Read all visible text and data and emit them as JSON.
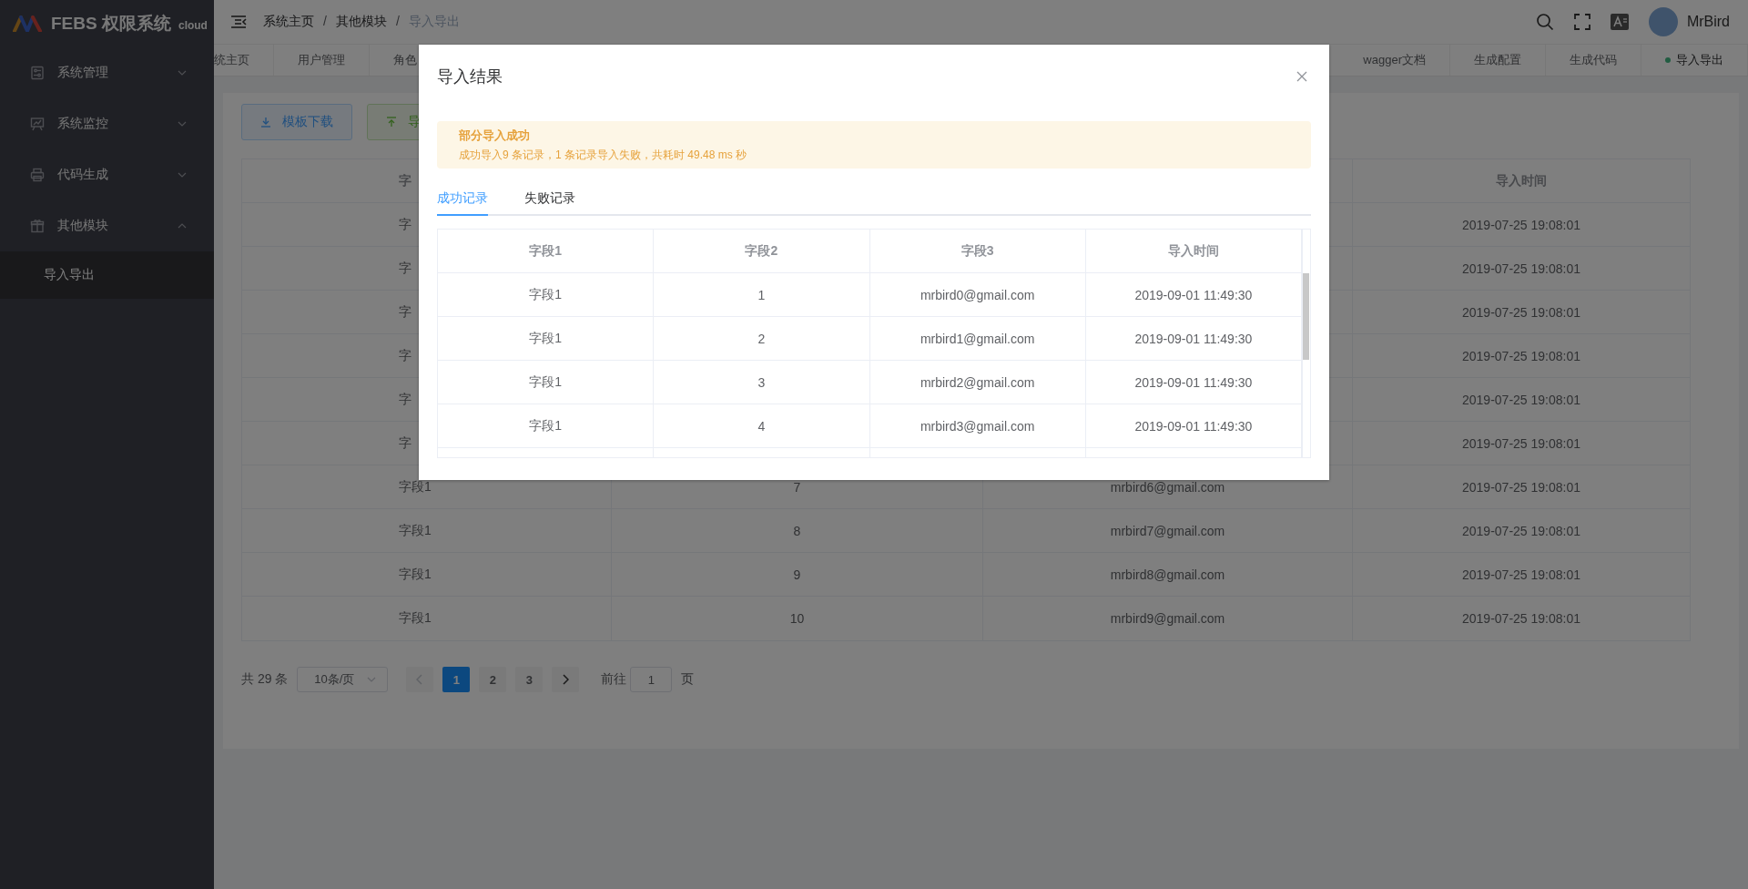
{
  "app": {
    "logo_text": "FEBS 权限系统",
    "logo_suffix": "cloud"
  },
  "sidebar": {
    "items": [
      {
        "label": "系统管理",
        "expanded": false
      },
      {
        "label": "系统监控",
        "expanded": false
      },
      {
        "label": "代码生成",
        "expanded": false
      },
      {
        "label": "其他模块",
        "expanded": true,
        "children": [
          {
            "label": "导入导出",
            "selected": true
          }
        ]
      }
    ]
  },
  "header": {
    "breadcrumb": [
      "系统主页",
      "其他模块",
      "导入导出"
    ],
    "breadcrumb_separator": "/",
    "user": "MrBird"
  },
  "tabs_left": [
    {
      "label": "统主页",
      "selected": false
    },
    {
      "label": "用户管理",
      "selected": false
    },
    {
      "label": "角色",
      "selected": false
    }
  ],
  "tabs_right": [
    {
      "label": "wagger文档",
      "selected": false
    },
    {
      "label": "生成配置",
      "selected": false
    },
    {
      "label": "生成代码",
      "selected": false
    },
    {
      "label": "导入导出",
      "selected": true
    }
  ],
  "toolbar": {
    "buttons": [
      {
        "label": "模板下载",
        "kind": "download"
      },
      {
        "label": "导",
        "kind": "upload"
      }
    ]
  },
  "table": {
    "columns": [
      "字",
      null,
      null,
      "导入时间"
    ],
    "rows": [
      [
        "字",
        null,
        null,
        "2019-07-25 19:08:01"
      ],
      [
        "字",
        null,
        null,
        "2019-07-25 19:08:01"
      ],
      [
        "字",
        null,
        null,
        "2019-07-25 19:08:01"
      ],
      [
        "字",
        null,
        null,
        "2019-07-25 19:08:01"
      ],
      [
        "字",
        null,
        null,
        "2019-07-25 19:08:01"
      ],
      [
        "字",
        null,
        null,
        "2019-07-25 19:08:01"
      ],
      [
        "字段1",
        "7",
        "mrbird6@gmail.com",
        "2019-07-25 19:08:01"
      ],
      [
        "字段1",
        "8",
        "mrbird7@gmail.com",
        "2019-07-25 19:08:01"
      ],
      [
        "字段1",
        "9",
        "mrbird8@gmail.com",
        "2019-07-25 19:08:01"
      ],
      [
        "字段1",
        "10",
        "mrbird9@gmail.com",
        "2019-07-25 19:08:01"
      ]
    ]
  },
  "pagination": {
    "total": "共 29 条",
    "page_size": "10条/页",
    "pages": [
      {
        "label": "1",
        "selected": true
      },
      {
        "label": "2",
        "selected": false
      },
      {
        "label": "3",
        "selected": false
      }
    ],
    "goto_label": "前往",
    "goto_value": "1",
    "goto_suffix": "页"
  },
  "dialog": {
    "title": "导入结果",
    "alert": {
      "title": "部分导入成功",
      "message": "成功导入9 条记录，1 条记录导入失败，共耗时 49.48 ms 秒"
    },
    "tabs": [
      {
        "label": "成功记录",
        "selected": true
      },
      {
        "label": "失败记录",
        "selected": false
      }
    ],
    "table": {
      "columns": [
        "字段1",
        "字段2",
        "字段3",
        "导入时间"
      ],
      "rows": [
        [
          "字段1",
          "1",
          "mrbird0@gmail.com",
          "2019-09-01 11:49:30"
        ],
        [
          "字段1",
          "2",
          "mrbird1@gmail.com",
          "2019-09-01 11:49:30"
        ],
        [
          "字段1",
          "3",
          "mrbird2@gmail.com",
          "2019-09-01 11:49:30"
        ],
        [
          "字段1",
          "4",
          "mrbird3@gmail.com",
          "2019-09-01 11:49:30"
        ]
      ]
    }
  }
}
